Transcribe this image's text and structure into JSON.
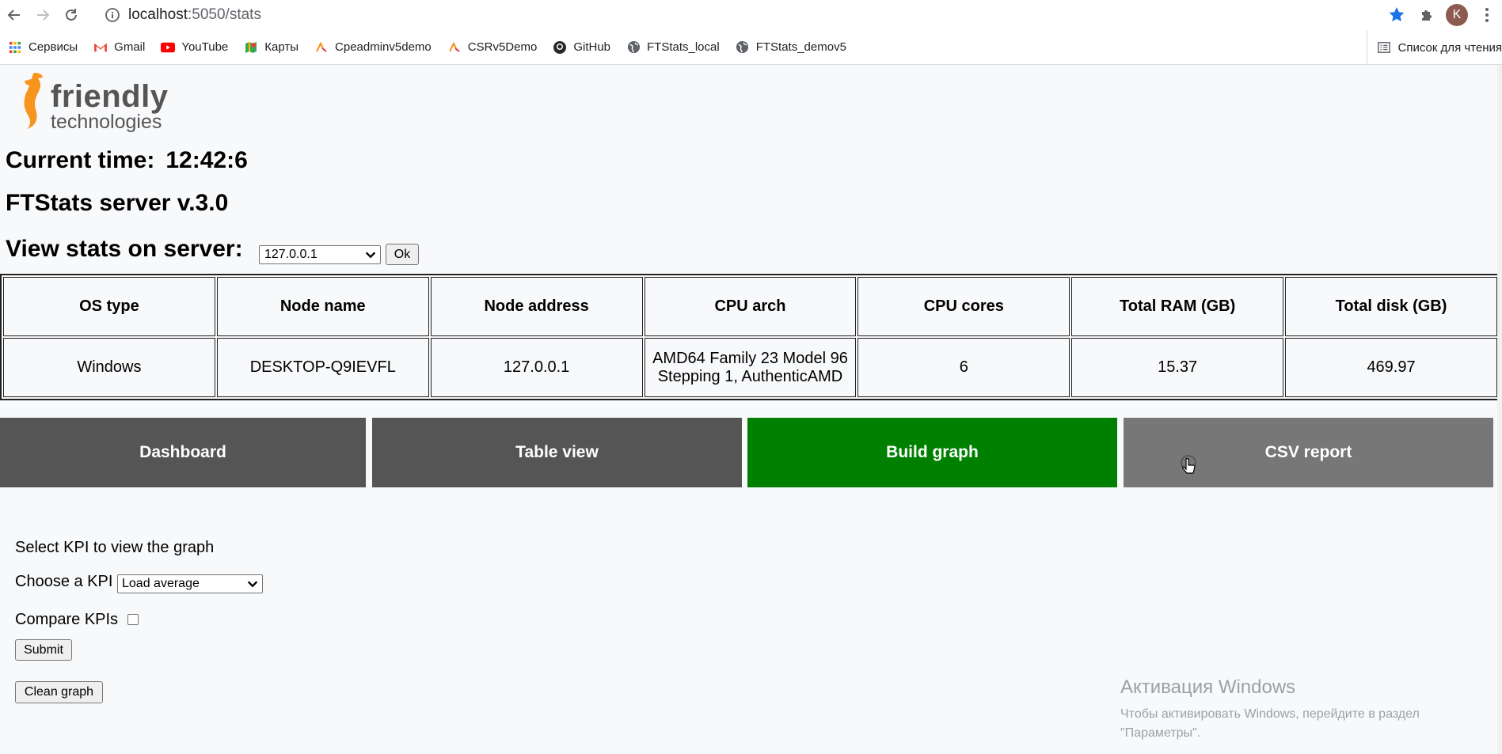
{
  "browser": {
    "url_host": "localhost",
    "url_path": ":5050/stats",
    "avatar_letter": "K",
    "bookmarks": [
      {
        "label": "Сервисы",
        "icon": "apps-grid-icon"
      },
      {
        "label": "Gmail",
        "icon": "gmail-icon"
      },
      {
        "label": "YouTube",
        "icon": "youtube-icon"
      },
      {
        "label": "Карты",
        "icon": "maps-icon"
      },
      {
        "label": "Cpeadminv5demo",
        "icon": "friendly-icon"
      },
      {
        "label": "CSRv5Demo",
        "icon": "friendly-icon"
      },
      {
        "label": "GitHub",
        "icon": "github-icon"
      },
      {
        "label": "FTStats_local",
        "icon": "globe-icon"
      },
      {
        "label": "FTStats_demov5",
        "icon": "globe-icon"
      }
    ],
    "reading_list": "Список для чтения"
  },
  "logo": {
    "line1": "friendly",
    "line2": "technologies",
    "color": "#f7941d"
  },
  "header": {
    "current_time_label": "Current time:",
    "current_time_value": "12:42:6",
    "version": "FTStats server v.3.0",
    "view_stats_label": "View stats on server:",
    "server_selected": "127.0.0.1",
    "ok_label": "Ok"
  },
  "table": {
    "headers": [
      "OS type",
      "Node name",
      "Node address",
      "CPU arch",
      "CPU cores",
      "Total RAM (GB)",
      "Total disk (GB)"
    ],
    "row": [
      "Windows",
      "DESKTOP-Q9IEVFL",
      "127.0.0.1",
      "AMD64 Family 23 Model 96 Stepping 1, AuthenticAMD",
      "6",
      "15.37",
      "469.97"
    ]
  },
  "tabs": [
    {
      "label": "Dashboard",
      "color": "#555555"
    },
    {
      "label": "Table view",
      "color": "#555555"
    },
    {
      "label": "Build graph",
      "color": "#008000"
    },
    {
      "label": "CSV report",
      "color": "#777777"
    }
  ],
  "form": {
    "select_kpi_text": "Select KPI to view the graph",
    "choose_kpi_label": "Choose a KPI",
    "kpi_selected": "Load average",
    "compare_label": "Compare KPIs",
    "compare_checked": false,
    "submit_label": "Submit",
    "clean_label": "Clean graph"
  },
  "watermark": {
    "title": "Активация Windows",
    "line1": "Чтобы активировать Windows, перейдите в раздел",
    "line2": "\"Параметры\"."
  }
}
